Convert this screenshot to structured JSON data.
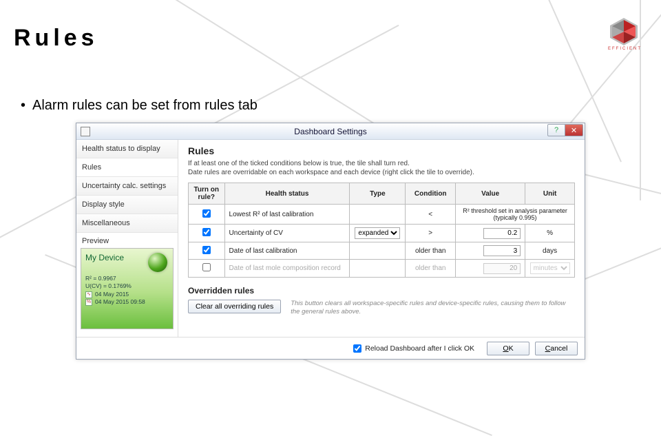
{
  "slide": {
    "title": "Rules",
    "bullet": "Alarm rules can be set from rules tab",
    "logo_label": "EFFICIENT"
  },
  "window": {
    "title": "Dashboard Settings",
    "help_glyph": "?",
    "close_glyph": "✕"
  },
  "sidebar": {
    "items": [
      {
        "label": "Health status to display"
      },
      {
        "label": "Rules"
      },
      {
        "label": "Uncertainty calc. settings"
      },
      {
        "label": "Display style"
      },
      {
        "label": "Miscellaneous"
      }
    ],
    "preview_label": "Preview",
    "preview": {
      "device": "My Device",
      "r2": "R² = 0.9967",
      "ucv": "U(CV) = 0.1769%",
      "date1": "04 May 2015",
      "date2": "04 May 2015  09:58"
    }
  },
  "rules": {
    "heading": "Rules",
    "desc1": "If at least one of the ticked conditions below is true, the tile shall turn red.",
    "desc2": "Date rules are overridable on each workspace and each device (right click the tile to override).",
    "headers": {
      "turn_on": "Turn on rule?",
      "health": "Health status",
      "type": "Type",
      "cond": "Condition",
      "value": "Value",
      "unit": "Unit"
    },
    "rows": [
      {
        "checked": true,
        "health": "Lowest R² of last calibration",
        "type": "",
        "cond": "<",
        "value_text": "R² threshold set in analysis parameter (typically 0.995)",
        "unit": ""
      },
      {
        "checked": true,
        "health": "Uncertainty of CV",
        "type_select": "expanded",
        "cond": ">",
        "value": "0.2",
        "unit": "%"
      },
      {
        "checked": true,
        "health": "Date of last calibration",
        "type": "",
        "cond": "older than",
        "value": "3",
        "unit": "days"
      },
      {
        "checked": false,
        "health": "Date of last mole composition record",
        "type": "",
        "cond": "older than",
        "value": "20",
        "unit_select": "minutes"
      }
    ],
    "override_heading": "Overridden rules",
    "clear_btn": "Clear all overriding rules",
    "clear_hint": "This button clears all workspace-specific rules and device-specific rules, causing them to follow the general rules above."
  },
  "footer": {
    "reload": "Reload Dashboard after I click OK",
    "ok": "OK",
    "cancel": "Cancel"
  }
}
